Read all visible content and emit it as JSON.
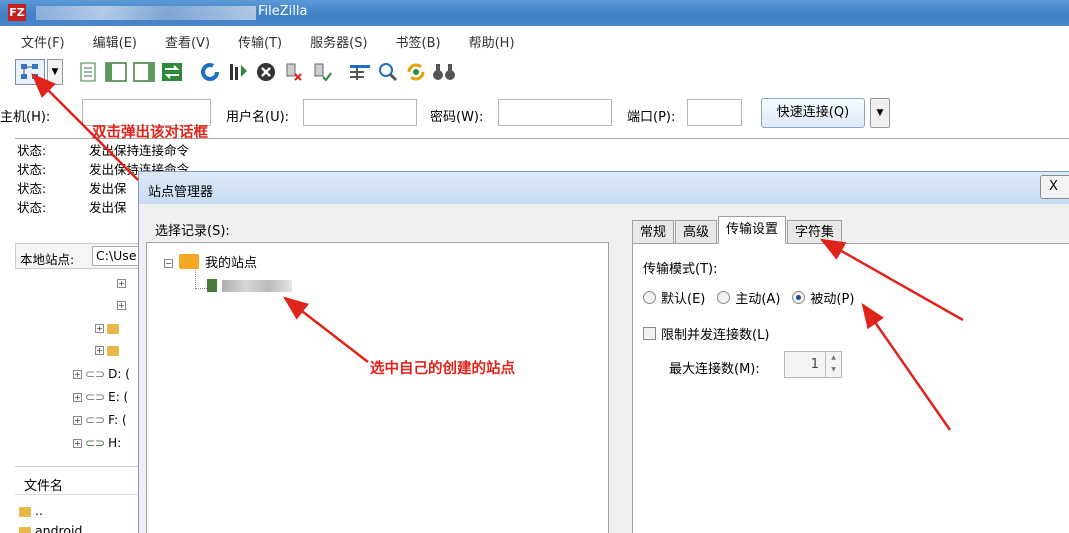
{
  "app": {
    "title": "FileZilla",
    "icon_glyph": "FZ"
  },
  "menu": [
    "文件(F)",
    "编辑(E)",
    "查看(V)",
    "传输(T)",
    "服务器(S)",
    "书签(B)",
    "帮助(H)"
  ],
  "toolbar": {
    "icons": [
      "site-manager-icon",
      "dropdown-arrow-icon",
      "message-log-icon",
      "local-tree-icon",
      "remote-tree-icon",
      "transfer-queue-icon",
      "refresh-icon",
      "process-queue-icon",
      "cancel-icon",
      "disconnect-icon",
      "reconnect-icon",
      "filter-icon",
      "compare-icon",
      "sync-browse-icon",
      "search-icon"
    ]
  },
  "quickconnect": {
    "host_label": "主机(H):",
    "user_label": "用户名(U):",
    "pass_label": "密码(W):",
    "port_label": "端口(P):",
    "connect_button": "快速连接(Q)"
  },
  "log": [
    {
      "key": "状态:",
      "text": "发出保持连接命令"
    },
    {
      "key": "状态:",
      "text": "发出保持连接命令"
    },
    {
      "key": "状态:",
      "text": "发出保"
    },
    {
      "key": "状态:",
      "text": "发出保"
    }
  ],
  "local": {
    "label": "本地站点:",
    "path": "C:\\Use",
    "tree": [
      {
        "label": "D: (",
        "icon": "drive-icon"
      },
      {
        "label": "E: (",
        "icon": "drive-icon"
      },
      {
        "label": "F: (",
        "icon": "drive-icon"
      },
      {
        "label": "H:",
        "icon": "network-drive-icon"
      }
    ],
    "filename_header": "文件名",
    "files": [
      "..",
      "android"
    ]
  },
  "dialog": {
    "title": "站点管理器",
    "close_glyph": "X",
    "select_label": "选择记录(S):",
    "root_node": "我的站点",
    "tabs": [
      "常规",
      "高级",
      "传输设置",
      "字符集"
    ],
    "active_tab": "传输设置",
    "transfer_mode_label": "传输模式(T):",
    "modes": [
      {
        "label": "默认(E)",
        "checked": false
      },
      {
        "label": "主动(A)",
        "checked": false
      },
      {
        "label": "被动(P)",
        "checked": true
      }
    ],
    "limit_label": "限制并发连接数(L)",
    "max_conn_label": "最大连接数(M):",
    "max_conn_value": "1"
  },
  "annotations": {
    "double_click": "双击弹出该对话框",
    "select_site": "选中自己的创建的站点",
    "color": "#e0241b"
  }
}
